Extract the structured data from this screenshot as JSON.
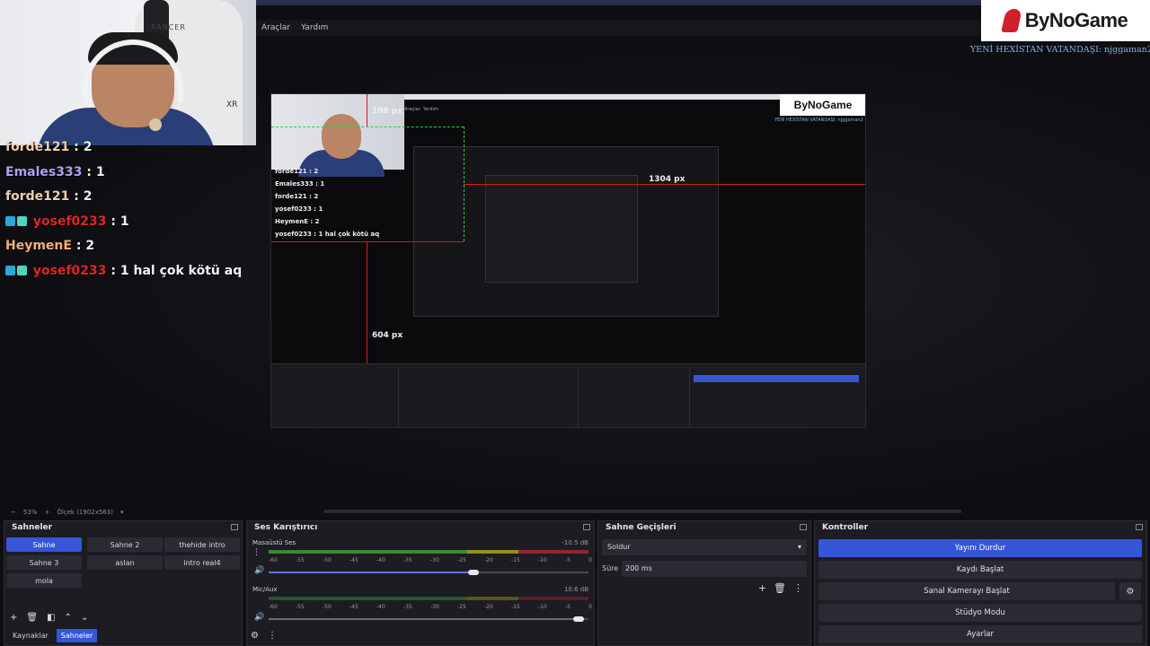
{
  "menu": {
    "tools": "Araçlar",
    "help": "Yardım"
  },
  "brand": {
    "name": "ByNoGame",
    "subtitle": "YENİ HEXİSTAN VATANDAŞI: njggaman2"
  },
  "webcam": {
    "chair_brand": "RANCER",
    "chair_model": "XR"
  },
  "chat": [
    {
      "user": "forde121",
      "user_color": "#f0d0b0",
      "msg": "2",
      "badges": false
    },
    {
      "user": "Emales333",
      "user_color": "#a9a4f2",
      "msg": "1",
      "badges": false
    },
    {
      "user": "forde121",
      "user_color": "#f0d0b0",
      "msg": "2",
      "badges": false
    },
    {
      "user": "yosef0233",
      "user_color": "#e02626",
      "msg": "1",
      "badges": true
    },
    {
      "user": "HeymenE",
      "user_color": "#f2b07a",
      "msg": "2",
      "badges": false
    },
    {
      "user": "yosef0233",
      "user_color": "#e02626",
      "msg": "1 hal çok kötü aq",
      "badges": true
    }
  ],
  "preview": {
    "px_labels": {
      "top": "108 px",
      "right": "1304 px",
      "bottom": "604 px"
    },
    "inner_brand": "ByNoGame",
    "inner_sub": "YENİ HEXİSTAN VATANDAŞI: njggaman2",
    "inner_chat": [
      "forde121 : 2",
      "Emales333 : 1",
      "forde121 : 2",
      "yosef0233 : 1",
      "HeymenE : 2",
      "yosef0233 : 1 hal çok kötü aq"
    ]
  },
  "zoom": {
    "percent": "53%",
    "scale": "Ölçek (1902x563)"
  },
  "scenes": {
    "title": "Sahneler",
    "items": [
      "Sahne",
      "Sahne 2",
      "thehide intro",
      "Sahne 3",
      "aslan",
      "intro real4",
      "mola"
    ],
    "active_index": 0,
    "tabs": [
      "Kaynaklar",
      "Sahneler"
    ],
    "active_tab": 1
  },
  "mixer": {
    "title": "Ses Karıştırıcı",
    "channels": [
      {
        "name": "Masaüstü Ses",
        "db": "-10.5 dB",
        "level": 0.72,
        "volume": 0.64
      },
      {
        "name": "Mic/Aux",
        "db": "10.6 dB",
        "level": 0.0,
        "volume": 0.98
      }
    ],
    "ticks": [
      "-60",
      "-55",
      "-50",
      "-45",
      "-40",
      "-35",
      "-30",
      "-25",
      "-20",
      "-15",
      "-10",
      "-5",
      "0"
    ]
  },
  "transitions": {
    "title": "Sahne Geçişleri",
    "selected": "Soldur",
    "duration_label": "Süre",
    "duration_value": "200 ms"
  },
  "controls": {
    "title": "Kontroller",
    "buttons": [
      "Yayını Durdur",
      "Kaydı Başlat",
      "Sanal Kamerayı Başlat",
      "Stüdyo Modu",
      "Ayarlar"
    ]
  },
  "colors": {
    "accent": "#3656d8",
    "guide": "#d31a1a",
    "guide_green": "#26d13a"
  }
}
